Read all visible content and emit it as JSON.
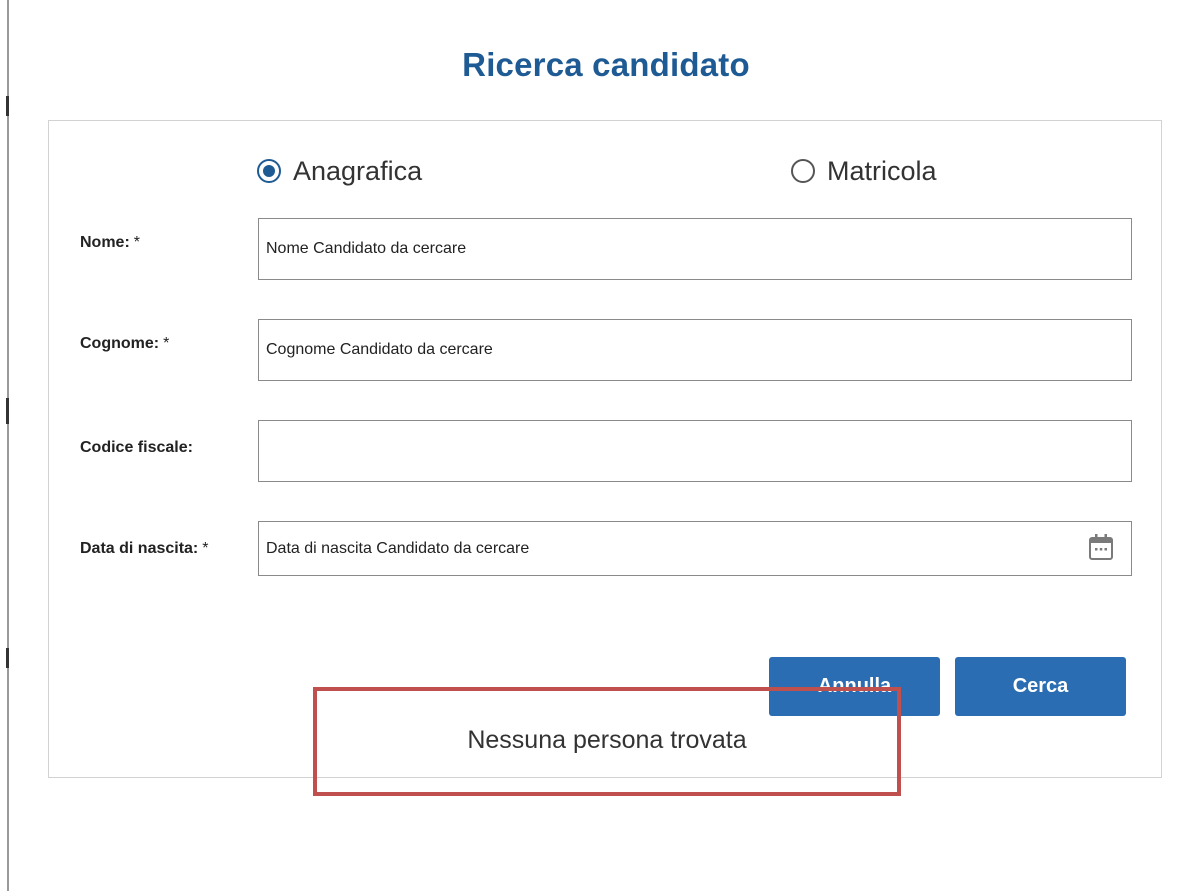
{
  "dialog": {
    "title": "Ricerca candidato"
  },
  "search_mode": {
    "options": [
      {
        "label": "Anagrafica",
        "checked": true
      },
      {
        "label": "Matricola",
        "checked": false
      }
    ]
  },
  "form": {
    "nome": {
      "label": "Nome:",
      "required_mark": "*",
      "value": "",
      "placeholder": "Nome Candidato da cercare"
    },
    "cognome": {
      "label": "Cognome:",
      "required_mark": "*",
      "value": "",
      "placeholder": "Cognome Candidato da cercare"
    },
    "codice_fiscale": {
      "label": "Codice fiscale:",
      "value": "",
      "placeholder": ""
    },
    "data_nascita": {
      "label": "Data di nascita:",
      "required_mark": "*",
      "value": "",
      "placeholder": "Data di nascita Candidato da cercare",
      "icon": "calendar-icon"
    }
  },
  "actions": {
    "annulla_label": "Annulla",
    "cerca_label": "Cerca"
  },
  "result": {
    "message": "Nessuna persona trovata"
  },
  "colors": {
    "title": "#1e5a93",
    "button_bg": "#2a6db2",
    "highlight_border": "#c0504d",
    "radio_selected": "#1e5a93"
  }
}
